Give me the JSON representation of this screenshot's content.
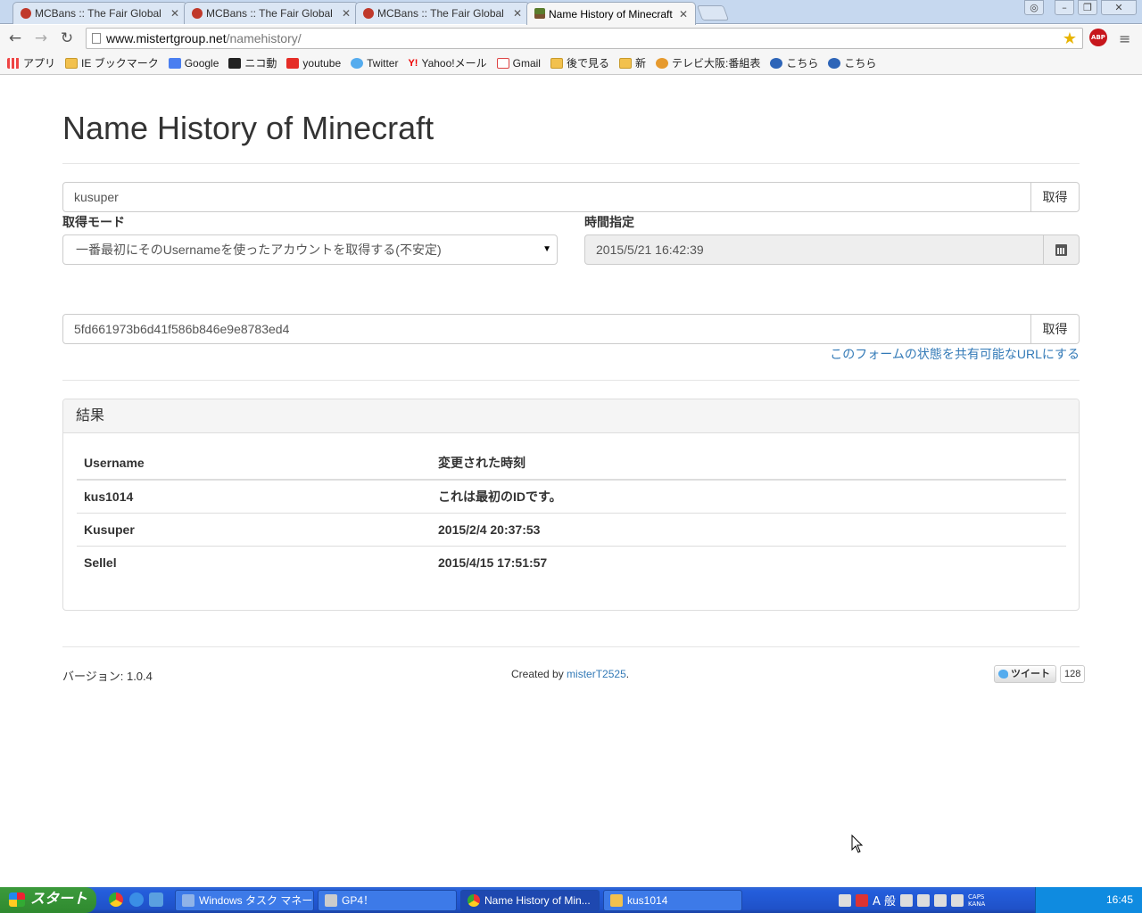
{
  "browser": {
    "tabs": [
      {
        "title": "MCBans :: The Fair Global",
        "active": false
      },
      {
        "title": "MCBans :: The Fair Global",
        "active": false
      },
      {
        "title": "MCBans :: The Fair Global",
        "active": false
      },
      {
        "title": "Name History of Minecraft",
        "active": true
      }
    ],
    "url_host": "www.mistertgroup.net",
    "url_path": "/namehistory/",
    "abp_label": "ABP",
    "bookmarks": [
      {
        "label": "アプリ",
        "icon": "apps-icon"
      },
      {
        "label": "IE ブックマーク",
        "icon": "folder-icon"
      },
      {
        "label": "Google",
        "icon": "google-icon"
      },
      {
        "label": "ニコ動",
        "icon": "niconico-icon"
      },
      {
        "label": "youtube",
        "icon": "youtube-icon"
      },
      {
        "label": "Twitter",
        "icon": "twitter-icon"
      },
      {
        "label": "Yahoo!メール",
        "icon": "yahoo-icon"
      },
      {
        "label": "Gmail",
        "icon": "gmail-icon"
      },
      {
        "label": "後で見る",
        "icon": "folder-icon"
      },
      {
        "label": "新",
        "icon": "folder-icon"
      },
      {
        "label": "テレビ大阪:番組表",
        "icon": "tv-icon"
      },
      {
        "label": "こちら",
        "icon": "ie-icon"
      },
      {
        "label": "こちら",
        "icon": "ie-icon"
      }
    ]
  },
  "page": {
    "title": "Name History of Minecraft",
    "username_input": "kusuper",
    "get_button": "取得",
    "mode_label": "取得モード",
    "mode_selected": "一番最初にそのUsernameを使ったアカウントを取得する(不安定)",
    "time_label": "時間指定",
    "time_value": "2015/5/21 16:42:39",
    "uuid_input": "5fd661973b6d41f586b846e9e8783ed4",
    "uuid_button": "取得",
    "share_link": "このフォームの状態を共有可能なURLにする",
    "results": {
      "heading": "結果",
      "columns": [
        "Username",
        "変更された時刻"
      ],
      "rows": [
        [
          "kus1014",
          "これは最初のIDです。"
        ],
        [
          "Kusuper",
          "2015/2/4 20:37:53"
        ],
        [
          "Sellel",
          "2015/4/15 17:51:57"
        ]
      ]
    },
    "footer": {
      "version": "バージョン: 1.0.4",
      "created_by_prefix": "Created by ",
      "author": "misterT2525",
      "created_by_suffix": ".",
      "tweet_label": "ツイート",
      "tweet_count": "128"
    }
  },
  "taskbar": {
    "start_label": "スタート",
    "tasks": [
      {
        "label": "Windows タスク マネー...",
        "active": false
      },
      {
        "label": "GP4！",
        "active": false
      },
      {
        "label": "Name History of Min...",
        "active": true
      },
      {
        "label": "kus1014",
        "active": false
      }
    ],
    "ime_label": "A 般",
    "caps": "CAPS",
    "kana": "KANA",
    "clock": "16:45"
  },
  "colors": {
    "link": "#337ab7",
    "taskbar": "#245edc",
    "start": "#3c9a3c"
  }
}
